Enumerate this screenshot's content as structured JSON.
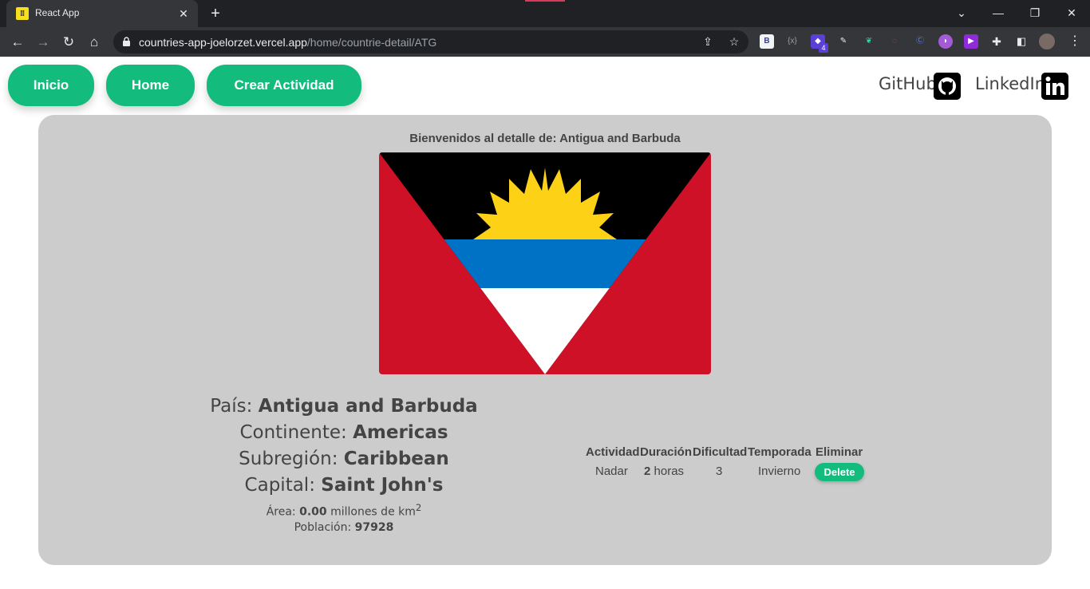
{
  "browser": {
    "tab_title": "React App",
    "tab_favicon": "react-icon",
    "url_domain": "countries-app-joelorzet.vercel.app",
    "url_path": "/home/countrie-detail/ATG",
    "extension_badge": "4",
    "extension_b_label": "B"
  },
  "nav": {
    "inicio": "Inicio",
    "home": "Home",
    "crear": "Crear Actividad",
    "github": "GitHub",
    "linkedin": "LinkedIn",
    "accent_color": "#13bb7d"
  },
  "detail": {
    "welcome": "Bienvenidos al detalle de: Antigua and Barbuda",
    "country_label": "País:",
    "country": "Antigua and Barbuda",
    "continent_label": "Continente:",
    "continent": "Americas",
    "subregion_label": "Subregión:",
    "subregion": "Caribbean",
    "capital_label": "Capital:",
    "capital": "Saint John's",
    "area_label": "Área:",
    "area_value": "0.00",
    "area_unit": "millones de km",
    "area_sup": "2",
    "population_label": "Población:",
    "population": "97928"
  },
  "activities": {
    "headers": [
      "Actividad",
      "Duración",
      "Dificultad",
      "Temporada",
      "Eliminar"
    ],
    "rows": [
      {
        "name": "Nadar",
        "duration_value": "2",
        "duration_unit": "horas",
        "difficulty": "3",
        "season": "Invierno",
        "delete_label": "Delete"
      }
    ]
  }
}
